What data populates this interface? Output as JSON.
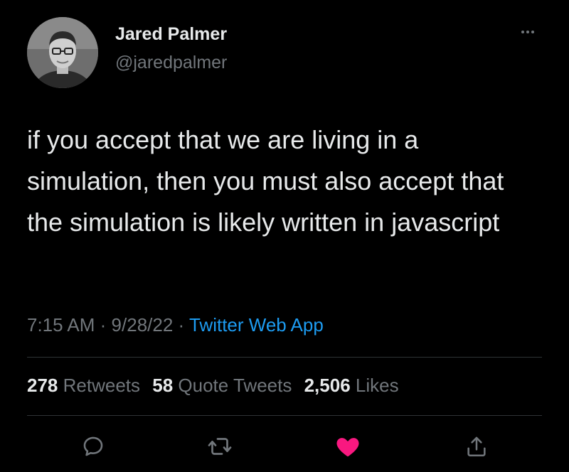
{
  "author": {
    "name": "Jared Palmer",
    "handle": "@jaredpalmer"
  },
  "tweet": {
    "text": "if you accept that we are living in a simulation, then you must also accept that the simulation is likely written in javascript",
    "time": "7:15 AM",
    "date": "9/28/22",
    "separator": "·",
    "source": "Twitter Web App"
  },
  "stats": {
    "retweets_count": "278",
    "retweets_label": "Retweets",
    "quotes_count": "58",
    "quotes_label": "Quote Tweets",
    "likes_count": "2,506",
    "likes_label": "Likes"
  },
  "icons": {
    "more": "more-horizontal-icon",
    "reply": "reply-icon",
    "retweet": "retweet-icon",
    "like": "heart-icon",
    "share": "share-icon"
  },
  "colors": {
    "background": "#000000",
    "text": "#e7e9ea",
    "secondary": "#71767b",
    "link": "#1d9bf0",
    "like": "#f91880"
  },
  "state": {
    "liked": true
  }
}
